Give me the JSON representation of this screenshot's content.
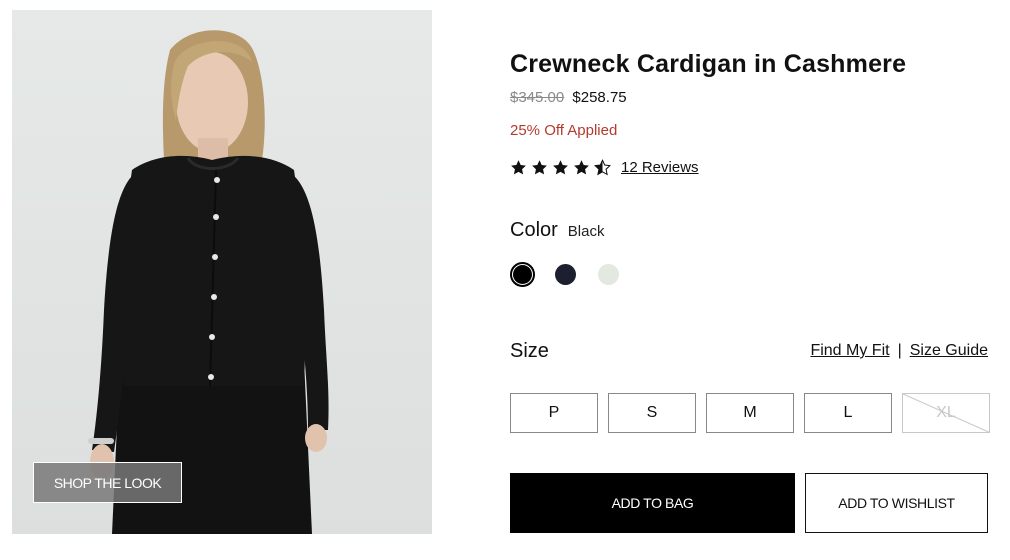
{
  "product": {
    "title": "Crewneck Cardigan in Cashmere",
    "price_original": "$345.00",
    "price_sale": "$258.75",
    "discount_text": "25% Off Applied",
    "rating": 4.5,
    "rating_max": 5,
    "reviews_label": "12 Reviews"
  },
  "image": {
    "shop_look_label": "SHOP THE LOOK"
  },
  "color": {
    "label": "Color",
    "selected_value": "Black",
    "swatches": [
      {
        "name": "Black",
        "hex": "#000000",
        "selected": true
      },
      {
        "name": "Navy",
        "hex": "#1b1f2e",
        "selected": false
      },
      {
        "name": "Ivory",
        "hex": "#e3e8e1",
        "selected": false
      }
    ]
  },
  "size": {
    "label": "Size",
    "find_fit_label": "Find My Fit",
    "separator": "|",
    "size_guide_label": "Size Guide",
    "options": [
      {
        "label": "P",
        "available": true
      },
      {
        "label": "S",
        "available": true
      },
      {
        "label": "M",
        "available": true
      },
      {
        "label": "L",
        "available": true
      },
      {
        "label": "XL",
        "available": false
      }
    ]
  },
  "actions": {
    "add_to_bag_label": "ADD TO BAG",
    "add_to_wishlist_label": "ADD TO WISHLIST"
  },
  "icons": [
    "star-full-icon",
    "star-half-icon"
  ]
}
